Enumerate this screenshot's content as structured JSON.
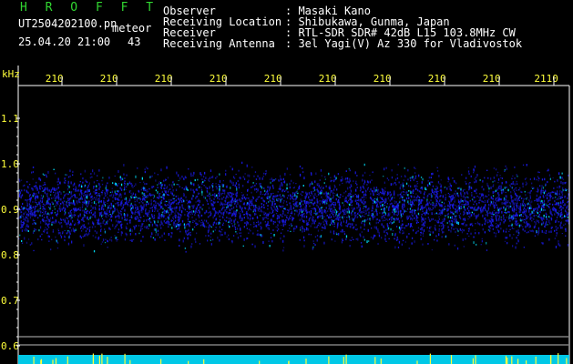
{
  "header": {
    "title": "H R O F F T",
    "filename": "UT2504202100.pn",
    "mode": "meteor",
    "datetime": "25.04.20 21:00",
    "count": "43",
    "info": [
      {
        "label": "Observer",
        "value": ": Masaki Kano"
      },
      {
        "label": "Receiving Location",
        "value": ": Shibukawa, Gunma, Japan"
      },
      {
        "label": "Receiver",
        "value": ": RTL-SDR SDR# 42dB L15 103.8MHz CW"
      },
      {
        "label": "Receiving Antenna",
        "value": ": 3el Yagi(V) Az 330 for Vladivostok"
      }
    ]
  },
  "spectrogram": {
    "unit": "kHz",
    "y_ticks": [
      "1.1",
      "1.0",
      "0.9",
      "0.8",
      "0.7",
      "0.6"
    ],
    "x_ticks": [
      "210",
      "210",
      "210",
      "210",
      "210",
      "210",
      "210",
      "210",
      "210",
      "2110"
    ],
    "signal_band_khz": [
      0.8,
      1.01
    ],
    "colors": {
      "background": "#000000",
      "axis": "#ffffff",
      "tick_label": "#ffff3a",
      "noise": "#1a1ae6",
      "hot": "#00e6ff"
    }
  }
}
